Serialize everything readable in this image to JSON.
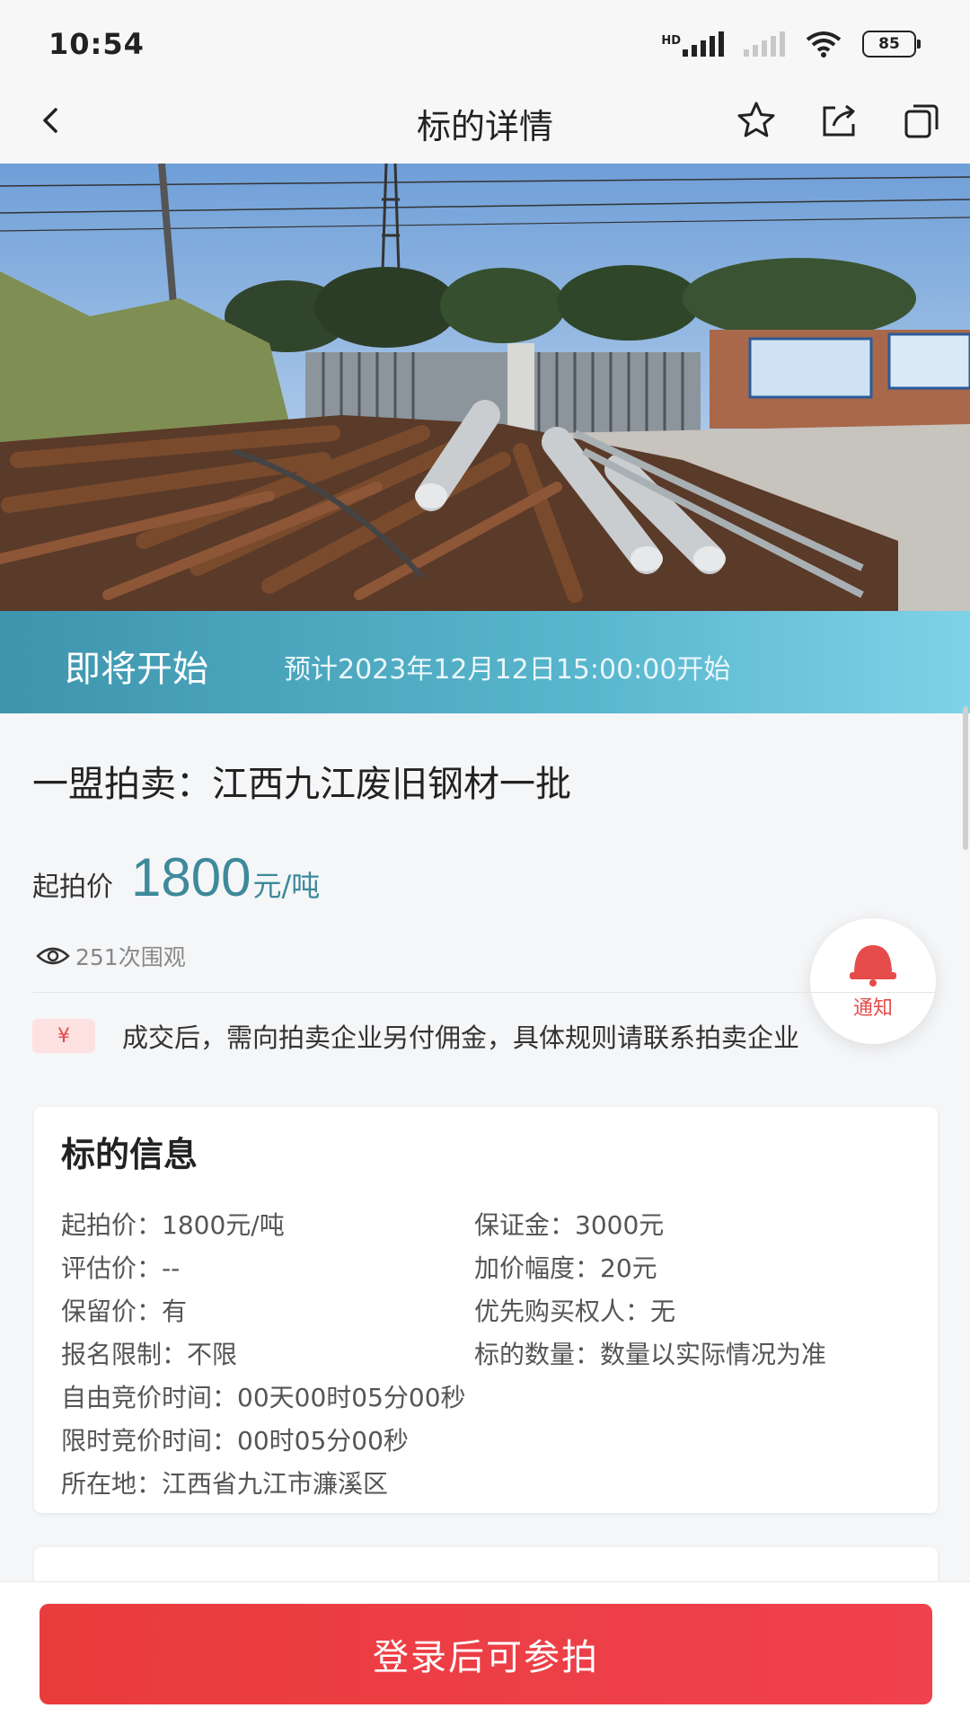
{
  "status_bar": {
    "time": "10:54",
    "battery": "85"
  },
  "nav": {
    "title": "标的详情"
  },
  "band": {
    "status": "即将开始",
    "schedule": "预计2023年12月12日15:00:00开始"
  },
  "lot": {
    "title": "一盟拍卖：江西九江废旧钢材一批",
    "price_label": "起拍价",
    "price_value": "1800",
    "price_unit": "元/吨",
    "views": "251次围观"
  },
  "notify": {
    "label": "通知"
  },
  "notice": {
    "badge": "¥",
    "text": "成交后，需向拍卖企业另付佣金，具体规则请联系拍卖企业"
  },
  "info_card": {
    "title": "标的信息",
    "rows": [
      "起拍价：1800元/吨",
      "保证金：3000元",
      "评估价：--",
      "加价幅度：20元",
      "保留价：有",
      "优先购买权人：无",
      "报名限制：不限",
      "标的数量：数量以实际情况为准",
      "自由竞价时间：00天00时05分00秒",
      "限时竞价时间：00时05分00秒",
      "所在地：江西省九江市濂溪区"
    ]
  },
  "cta": {
    "label": "登录后可参拍"
  }
}
